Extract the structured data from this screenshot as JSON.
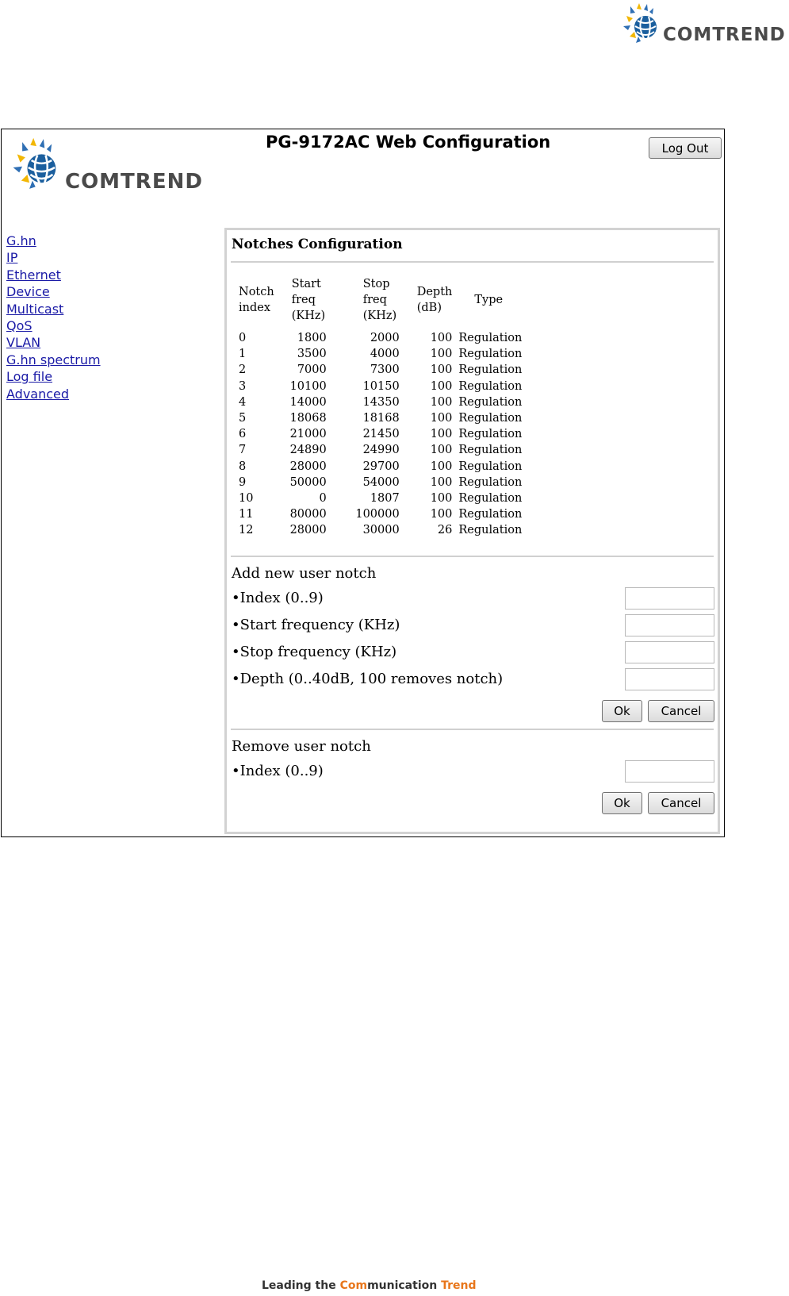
{
  "brand": {
    "name": "COMTREND",
    "colors": {
      "globe": "#1b5f9e",
      "rays_blue": "#2f6fb4",
      "rays_yellow": "#f2b705",
      "wordmark": "#4a4a4a"
    }
  },
  "header": {
    "title": "PG-9172AC Web Configuration",
    "logout_label": "Log Out"
  },
  "sidebar": {
    "items": [
      {
        "label": "G.hn"
      },
      {
        "label": "IP"
      },
      {
        "label": "Ethernet"
      },
      {
        "label": "Device"
      },
      {
        "label": "Multicast"
      },
      {
        "label": "QoS"
      },
      {
        "label": "VLAN"
      },
      {
        "label": "G.hn spectrum"
      },
      {
        "label": "Log file"
      },
      {
        "label": "Advanced"
      }
    ]
  },
  "notches": {
    "title": "Notches Configuration",
    "columns": {
      "index": [
        "Notch",
        "index"
      ],
      "start": [
        "Start freq",
        "(KHz)"
      ],
      "stop": [
        "Stop freq",
        "(KHz)"
      ],
      "depth": [
        "Depth",
        "(dB)"
      ],
      "type": "Type"
    },
    "rows": [
      [
        "0",
        "1800",
        "2000",
        "100",
        "Regulation"
      ],
      [
        "1",
        "3500",
        "4000",
        "100",
        "Regulation"
      ],
      [
        "2",
        "7000",
        "7300",
        "100",
        "Regulation"
      ],
      [
        "3",
        "10100",
        "10150",
        "100",
        "Regulation"
      ],
      [
        "4",
        "14000",
        "14350",
        "100",
        "Regulation"
      ],
      [
        "5",
        "18068",
        "18168",
        "100",
        "Regulation"
      ],
      [
        "6",
        "21000",
        "21450",
        "100",
        "Regulation"
      ],
      [
        "7",
        "24890",
        "24990",
        "100",
        "Regulation"
      ],
      [
        "8",
        "28000",
        "29700",
        "100",
        "Regulation"
      ],
      [
        "9",
        "50000",
        "54000",
        "100",
        "Regulation"
      ],
      [
        "10",
        "0",
        "1807",
        "100",
        "Regulation"
      ],
      [
        "11",
        "80000",
        "100000",
        "100",
        "Regulation"
      ],
      [
        "12",
        "28000",
        "30000",
        "26",
        "Regulation"
      ]
    ]
  },
  "add_notch": {
    "title": "Add new user notch",
    "index_label": "•Index (0..9)",
    "start_label": "•Start frequency (KHz)",
    "stop_label": "•Stop frequency (KHz)",
    "depth_label": "•Depth (0..40dB, 100 removes notch)",
    "index_value": "",
    "start_value": "",
    "stop_value": "",
    "depth_value": "",
    "ok_label": "Ok",
    "cancel_label": "Cancel"
  },
  "remove_notch": {
    "title": "Remove user notch",
    "index_label": "•Index (0..9)",
    "index_value": "",
    "ok_label": "Ok",
    "cancel_label": "Cancel"
  },
  "footer": {
    "tagline_parts": [
      "Leading the ",
      "Com",
      "munication ",
      "Trend"
    ],
    "accent_color": "#e8761b"
  }
}
